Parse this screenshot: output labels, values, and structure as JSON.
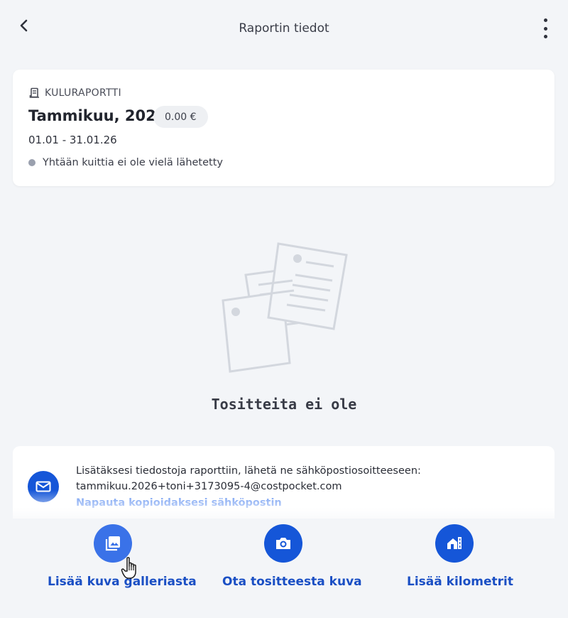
{
  "header": {
    "title": "Raportin tiedot"
  },
  "report": {
    "type_label": "KULURAPORTTI",
    "title": "Tammikuu, 2026",
    "amount": "0.00 €",
    "dates": "01.01 - 31.01.26",
    "status": "Yhtään kuittia ei ole vielä lähetetty"
  },
  "empty_state": {
    "title": "Tositteita ei ole"
  },
  "email_info": {
    "line1": "Lisätäksesi tiedostoja raporttiin, lähetä ne sähköpostiosoitteeseen:",
    "address": "tammikuu.2026+toni+3173095-4@costpocket.com",
    "copy_hint": "Napauta kopioidaksesi sähköpostin"
  },
  "actions": [
    {
      "label": "Lisää kuva galleriasta",
      "icon": "gallery-icon"
    },
    {
      "label": "Ota tositteesta kuva",
      "icon": "camera-icon"
    },
    {
      "label": "Lisää kilometrit",
      "icon": "home-road-icon"
    }
  ],
  "colors": {
    "accent": "#1556d8",
    "accent_text": "#1a4fc4",
    "background": "#f3f5f8",
    "status_dot": "#9aa0ae"
  }
}
